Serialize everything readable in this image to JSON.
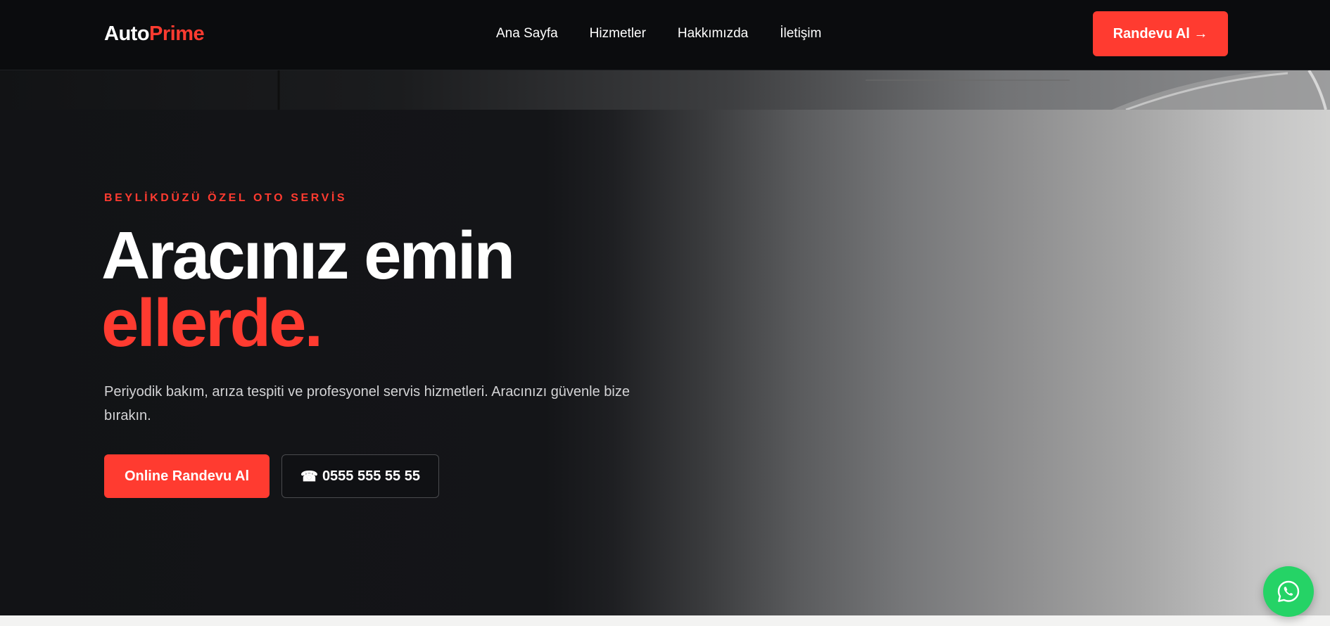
{
  "brand": {
    "logo_part1": "Auto",
    "logo_part2": "Prime",
    "accent_color": "#ff3b30"
  },
  "nav": {
    "links": [
      {
        "label": "Ana Sayfa"
      },
      {
        "label": "Hizmetler"
      },
      {
        "label": "Hakkımızda"
      },
      {
        "label": "İletişim"
      }
    ],
    "cta_label": "Randevu Al →"
  },
  "hero": {
    "eyebrow": "BEYLİKDÜZÜ ÖZEL OTO SERVİS",
    "headline_line1": "Aracınız emin",
    "headline_line2": "ellerde.",
    "description": "Periyodik bakım, arıza tespiti ve profesyonel servis hizmetleri. Aracınızı güvenle bize bırakın.",
    "primary_button": "Online Randevu Al",
    "phone_icon": "☎",
    "phone_number": "0555 555 55 55"
  },
  "floating": {
    "icon": "whatsapp-icon",
    "color": "#25d366"
  }
}
